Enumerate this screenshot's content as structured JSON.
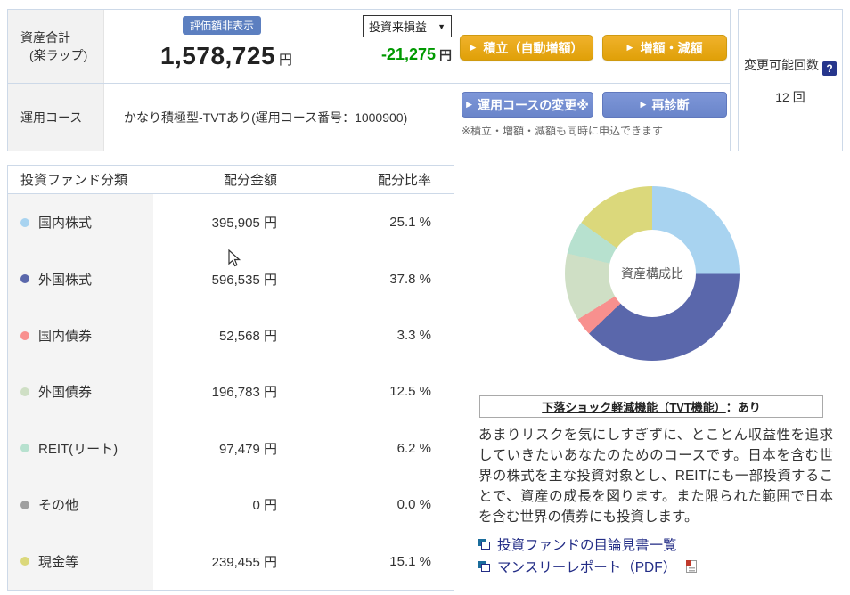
{
  "summary": {
    "asset_label_line1": "資産合計",
    "asset_label_line2": "(楽ラップ)",
    "hide_badge": "評価額非表示",
    "total_amount": "1,578,725",
    "currency_unit": "円",
    "period_select_value": "投資来損益",
    "profit_loss": "-21,275",
    "profit_color": "#009900",
    "tsumitate_button": "積立（自動増額）",
    "zougaku_button": "増額・減額",
    "course_label": "運用コース",
    "course_name": "かなり積極型-TVTあり(運用コース番号：1000900)",
    "course_change_button": "運用コースの変更※",
    "rediagnosis_button": "再診断",
    "apply_note": "※積立・増額・減額も同時に申込できます"
  },
  "change_count": {
    "label": "変更可能回数",
    "help_icon": "?",
    "value": "12 回"
  },
  "allocation": {
    "headers": [
      "投資ファンド分類",
      "配分金額",
      "配分比率"
    ],
    "rows": [
      {
        "label": "国内株式",
        "color": "#a8d3f0",
        "amount": "395,905 円",
        "ratio": "25.1 %"
      },
      {
        "label": "外国株式",
        "color": "#5a67ab",
        "amount": "596,535 円",
        "ratio": "37.8 %"
      },
      {
        "label": "国内債券",
        "color": "#f8908e",
        "amount": "52,568 円",
        "ratio": "3.3 %"
      },
      {
        "label": "外国債券",
        "color": "#cfdfc5",
        "amount": "196,783 円",
        "ratio": "12.5 %"
      },
      {
        "label": "REIT(リート)",
        "color": "#b7e1cf",
        "amount": "97,479 円",
        "ratio": "6.2 %"
      },
      {
        "label": "その他",
        "color": "#9f9f9f",
        "amount": "0 円",
        "ratio": "0.0 %"
      },
      {
        "label": "現金等",
        "color": "#dbd87b",
        "amount": "239,455 円",
        "ratio": "15.1 %"
      }
    ]
  },
  "chart_data": {
    "type": "pie",
    "donut": true,
    "title": "資産構成比",
    "center_label": "資産構成比",
    "labels": [
      "国内株式",
      "外国株式",
      "国内債券",
      "外国債券",
      "REIT(リート)",
      "その他",
      "現金等"
    ],
    "values": [
      25.1,
      37.8,
      3.3,
      12.5,
      6.2,
      0.0,
      15.1
    ],
    "amounts_yen": [
      395905,
      596535,
      52568,
      196783,
      97479,
      0,
      239455
    ],
    "colors": [
      "#a8d3f0",
      "#5a67ab",
      "#f8908e",
      "#cfdfc5",
      "#b7e1cf",
      "#9f9f9f",
      "#dbd87b"
    ],
    "start_angle_deg": 0,
    "direction": "clockwise",
    "legend_position": "table-left"
  },
  "tvt": {
    "title": "下落ショック軽減機能（TVT機能）",
    "status": "：あり"
  },
  "description": "あまりリスクを気にしすぎずに、とことん収益性を追求していきたいあなたのためのコースです。日本を含む世界の株式を主な投資対象とし、REITにも一部投資することで、資産の成長を図ります。また限られた範囲で日本を含む世界の債券にも投資します。",
  "links": [
    {
      "label": "投資ファンドの目論見書一覧"
    },
    {
      "label": "マンスリーレポート（PDF）"
    }
  ]
}
